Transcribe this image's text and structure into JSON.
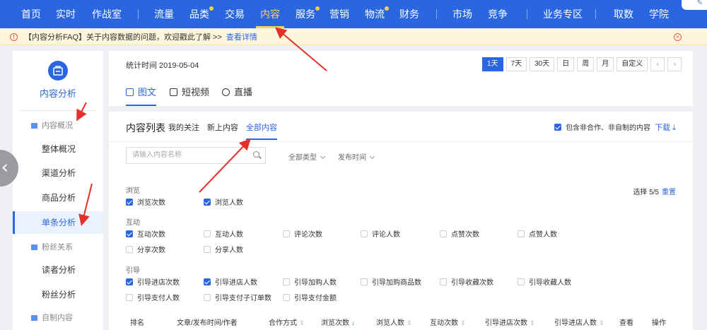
{
  "topnav": {
    "items": [
      {
        "label": "首页",
        "active": false,
        "dot": false
      },
      {
        "label": "实时",
        "active": false,
        "dot": false
      },
      {
        "label": "作战室",
        "active": false,
        "dot": false
      },
      {
        "label": "流量",
        "active": false,
        "dot": false
      },
      {
        "label": "品类",
        "active": false,
        "dot": true
      },
      {
        "label": "交易",
        "active": false,
        "dot": false
      },
      {
        "label": "内容",
        "active": true,
        "dot": false
      },
      {
        "label": "服务",
        "active": false,
        "dot": true
      },
      {
        "label": "营销",
        "active": false,
        "dot": false
      },
      {
        "label": "物流",
        "active": false,
        "dot": true
      },
      {
        "label": "财务",
        "active": false,
        "dot": false
      },
      {
        "label": "市场",
        "active": false,
        "dot": false
      },
      {
        "label": "竞争",
        "active": false,
        "dot": false
      },
      {
        "label": "业务专区",
        "active": false,
        "dot": false
      },
      {
        "label": "取数",
        "active": false,
        "dot": false
      },
      {
        "label": "学院",
        "active": false,
        "dot": false
      }
    ],
    "accent": "#2a66e0",
    "active_color": "#ffd54a"
  },
  "notice": {
    "text": "【内容分析FAQ】关于内容数据的问题，欢迎戳此了解 >>",
    "link": "查看详情"
  },
  "sidebar": {
    "title": "内容分析",
    "groups": [
      {
        "label": "内容概况",
        "items": [
          "整体概况",
          "渠道分析",
          "商品分析",
          "单条分析"
        ]
      },
      {
        "label": "粉丝关系",
        "items": [
          "读者分析",
          "粉丝分析"
        ]
      },
      {
        "label": "自制内容",
        "items": []
      }
    ],
    "active_item": "单条分析"
  },
  "header": {
    "stat_time": "统计时间 2019-05-04",
    "ranges": [
      "1天",
      "7天",
      "30天",
      "日",
      "周",
      "月",
      "自定义"
    ],
    "active_range": "1天",
    "prev": "‹",
    "next": "›",
    "tabs": [
      "图文",
      "短视频",
      "直播"
    ],
    "active_tab": "图文"
  },
  "content_list": {
    "title": "内容列表",
    "sub_tabs": [
      "我的关注",
      "新上内容",
      "全部内容"
    ],
    "active_sub_tab": "全部内容",
    "include_option": "包含非合作、非自制的内容",
    "include_checked": true,
    "download": "下载",
    "search_placeholder": "请输入内容名称",
    "filters": [
      "全部类型",
      "发布时间"
    ],
    "selected_count": "选择 5/5",
    "reset": "重置",
    "metric_groups": [
      {
        "label": "浏览",
        "metrics": [
          {
            "label": "浏览次数",
            "checked": true
          },
          {
            "label": "浏览人数",
            "checked": true
          }
        ]
      },
      {
        "label": "互动",
        "metrics": [
          {
            "label": "互动次数",
            "checked": true
          },
          {
            "label": "互动人数",
            "checked": false
          },
          {
            "label": "评论次数",
            "checked": false
          },
          {
            "label": "评论人数",
            "checked": false
          },
          {
            "label": "点赞次数",
            "checked": false
          },
          {
            "label": "点赞人数",
            "checked": false
          },
          {
            "label": "分享次数",
            "checked": false
          },
          {
            "label": "分享人数",
            "checked": false
          }
        ]
      },
      {
        "label": "引导",
        "metrics": [
          {
            "label": "引导进店次数",
            "checked": true
          },
          {
            "label": "引导进店人数",
            "checked": true
          },
          {
            "label": "引导加购人数",
            "checked": false
          },
          {
            "label": "引导加购商品数",
            "checked": false
          },
          {
            "label": "引导收藏次数",
            "checked": false
          },
          {
            "label": "引导收藏人数",
            "checked": false
          },
          {
            "label": "引导支付人数",
            "checked": false
          },
          {
            "label": "引导支付子订单数",
            "checked": false
          },
          {
            "label": "引导支付金额",
            "checked": false
          }
        ]
      }
    ],
    "columns": [
      {
        "label": "排名",
        "sort": ""
      },
      {
        "label": "文章/发布时间/作者",
        "sort": ""
      },
      {
        "label": "合作方式",
        "sort": "⇕"
      },
      {
        "label": "浏览次数",
        "sort": "↓"
      },
      {
        "label": "浏览人数",
        "sort": "⇕"
      },
      {
        "label": "互动次数",
        "sort": "⇕"
      },
      {
        "label": "引导进店次数",
        "sort": "⇕"
      },
      {
        "label": "引导进店人数",
        "sort": "⇕"
      },
      {
        "label": "查看",
        "sort": ""
      },
      {
        "label": "操作",
        "sort": ""
      }
    ],
    "sorted_column": "浏览次数"
  }
}
